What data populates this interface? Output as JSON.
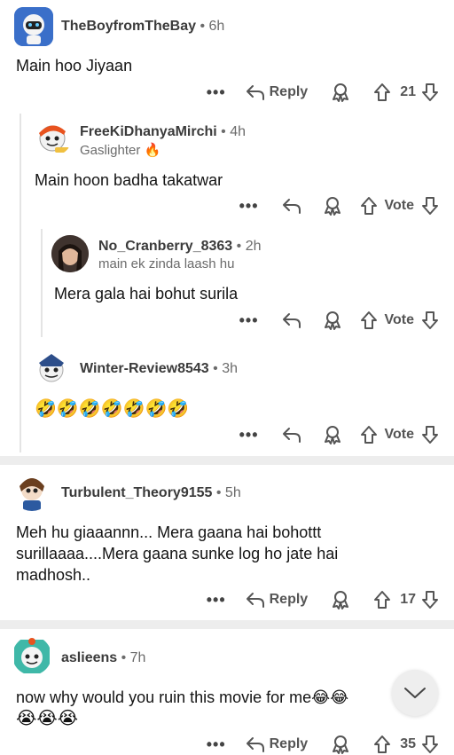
{
  "comments": [
    {
      "username": "TheBoyfromTheBay",
      "time": "6h",
      "text": "Main hoo Jiyaan",
      "reply_label": "Reply",
      "vote_count": "21"
    },
    {
      "username": "FreeKiDhanyaMirchi",
      "time": "4h",
      "flair": "Gaslighter 🔥",
      "text": "Main hoon badha takatwar",
      "vote_label": "Vote"
    },
    {
      "username": "No_Cranberry_8363",
      "time": "2h",
      "flair": "main ek zinda laash hu",
      "text": "Mera gala hai bohut surila",
      "vote_label": "Vote"
    },
    {
      "username": "Winter-Review8543",
      "time": "3h",
      "text": "🤣🤣🤣🤣🤣🤣🤣",
      "vote_label": "Vote"
    },
    {
      "username": "Turbulent_Theory9155",
      "time": "5h",
      "text": "Meh hu giaaannn... Mera gaana hai bohottt surillaaaa....Mera gaana sunke log ho jate hai madhosh..",
      "reply_label": "Reply",
      "vote_count": "17"
    },
    {
      "username": "aslieens",
      "time": "7h",
      "text": "now why would you ruin this movie for me😂😂",
      "text_line2": "😭😭😭",
      "reply_label": "Reply",
      "vote_count": "35"
    }
  ],
  "separator": "•",
  "more_label": "•••",
  "icons": [
    "more-icon",
    "reply-arrow-icon",
    "award-icon",
    "upvote-icon",
    "downvote-icon",
    "chevron-down-icon"
  ],
  "colors": {
    "separator": "#ededed",
    "thread_line": "#e4e4e4",
    "meta": "#6b6b6b"
  }
}
